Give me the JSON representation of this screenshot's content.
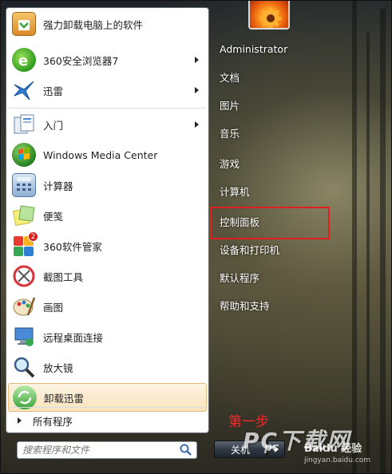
{
  "pinned_programs": [
    {
      "label": "强力卸载电脑上的软件",
      "icon": "uninstall-icon",
      "has_arrow": false
    },
    {
      "label": "360安全浏览器7",
      "icon": "browser-360-icon",
      "has_arrow": true
    },
    {
      "label": "迅雷",
      "icon": "thunder-icon",
      "has_arrow": true
    }
  ],
  "recent_programs": [
    {
      "label": "入门",
      "icon": "getting-started-icon",
      "has_arrow": true
    },
    {
      "label": "Windows Media Center",
      "icon": "media-center-icon",
      "has_arrow": false
    },
    {
      "label": "计算器",
      "icon": "calculator-icon",
      "has_arrow": false
    },
    {
      "label": "便笺",
      "icon": "sticky-notes-icon",
      "has_arrow": false
    },
    {
      "label": "360软件管家",
      "icon": "software-manager-360-icon",
      "has_arrow": false,
      "badge": "2"
    },
    {
      "label": "截图工具",
      "icon": "snipping-tool-icon",
      "has_arrow": false
    },
    {
      "label": "画图",
      "icon": "paint-icon",
      "has_arrow": false
    },
    {
      "label": "远程桌面连接",
      "icon": "remote-desktop-icon",
      "has_arrow": false
    },
    {
      "label": "放大镜",
      "icon": "magnifier-icon",
      "has_arrow": false
    },
    {
      "label": "卸载迅雷",
      "icon": "uninstall-thunder-icon",
      "has_arrow": false,
      "selected": true
    }
  ],
  "all_programs_label": "所有程序",
  "search": {
    "placeholder": "搜索程序和文件"
  },
  "right_panel": {
    "items": [
      {
        "label": "Administrator"
      },
      {
        "label": "文档"
      },
      {
        "label": "图片"
      },
      {
        "label": "音乐"
      },
      {
        "label": "游戏"
      },
      {
        "label": "计算机"
      },
      {
        "label": "控制面板",
        "highlighted": true
      },
      {
        "label": "设备和打印机"
      },
      {
        "label": "默认程序"
      },
      {
        "label": "帮助和支持"
      }
    ]
  },
  "shutdown": {
    "label": "关机"
  },
  "annotation": {
    "step": "第一步"
  },
  "watermark": {
    "main": "PC下载网",
    "sub": "pc",
    "baidu": "Baidu 经验",
    "url": "jingyan.baidu.com"
  },
  "colors": {
    "highlight_border": "#e02020",
    "step_text": "#ee2a2a",
    "selected_bg": "#fbe3bd"
  }
}
